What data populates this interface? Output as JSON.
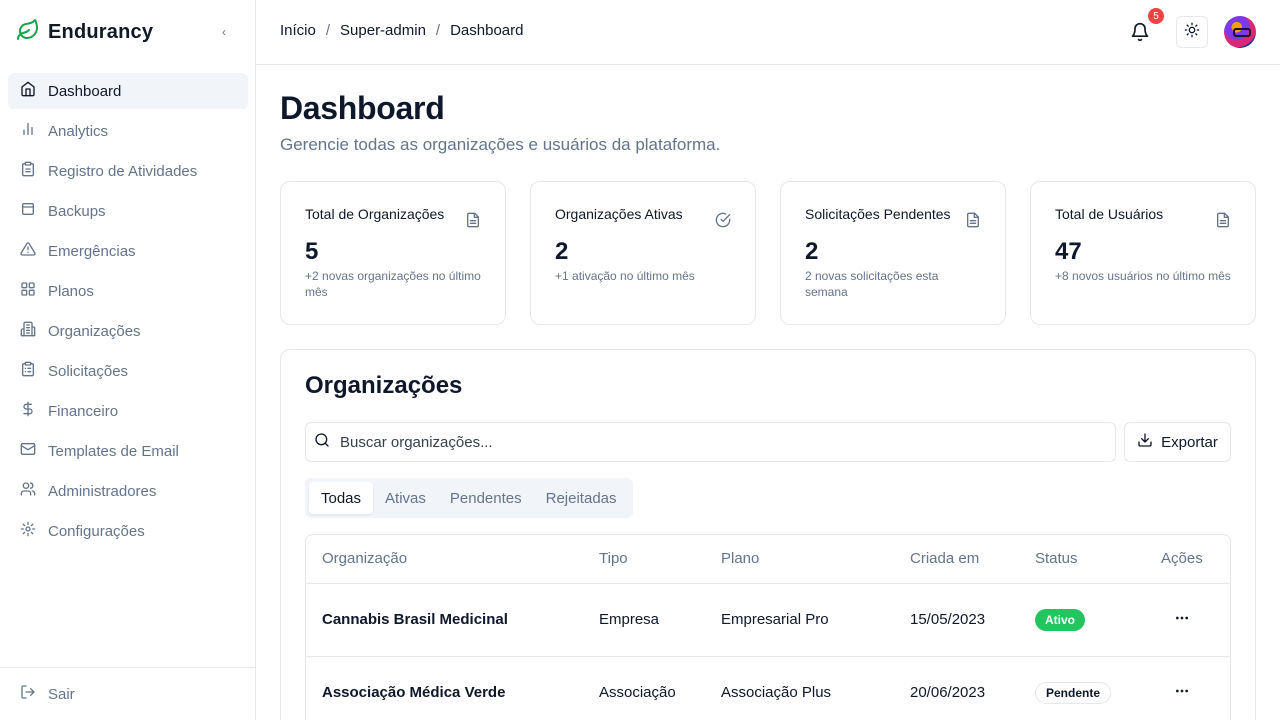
{
  "app": {
    "name": "Endurancy",
    "brand_color": "#16a34a"
  },
  "sidebar": {
    "collapse_icon": "chevron-left-icon",
    "items": [
      {
        "label": "Dashboard",
        "icon": "home-icon",
        "active": true
      },
      {
        "label": "Analytics",
        "icon": "bar-chart-icon"
      },
      {
        "label": "Registro de Atividades",
        "icon": "clipboard-icon"
      },
      {
        "label": "Backups",
        "icon": "database-icon"
      },
      {
        "label": "Emergências",
        "icon": "alert-triangle-icon"
      },
      {
        "label": "Planos",
        "icon": "grid-icon"
      },
      {
        "label": "Organizações",
        "icon": "building-icon"
      },
      {
        "label": "Solicitações",
        "icon": "clipboard-list-icon"
      },
      {
        "label": "Financeiro",
        "icon": "dollar-icon"
      },
      {
        "label": "Templates de Email",
        "icon": "mail-icon"
      },
      {
        "label": "Administradores",
        "icon": "users-icon"
      },
      {
        "label": "Configurações",
        "icon": "settings-icon"
      }
    ],
    "logout_label": "Sair"
  },
  "header": {
    "breadcrumb": [
      "Início",
      "Super-admin",
      "Dashboard"
    ],
    "separator": "/",
    "notification_count": "5",
    "notification_color": "#ef4444"
  },
  "page": {
    "title": "Dashboard",
    "subtitle": "Gerencie todas as organizações e usuários da plataforma."
  },
  "stats": [
    {
      "label": "Total de Organizações",
      "value": "5",
      "note": "+2 novas organizações no último mês",
      "icon": "file-icon"
    },
    {
      "label": "Organizações Ativas",
      "value": "2",
      "note": "+1 ativação no último mês",
      "icon": "check-circle-icon"
    },
    {
      "label": "Solicitações Pendentes",
      "value": "2",
      "note": "2 novas solicitações esta semana",
      "icon": "file-icon"
    },
    {
      "label": "Total de Usuários",
      "value": "47",
      "note": "+8 novos usuários no último mês",
      "icon": "file-icon"
    }
  ],
  "organizations": {
    "title": "Organizações",
    "search_placeholder": "Buscar organizações...",
    "export_label": "Exportar",
    "tabs": [
      {
        "label": "Todas",
        "active": true
      },
      {
        "label": "Ativas"
      },
      {
        "label": "Pendentes"
      },
      {
        "label": "Rejeitadas"
      }
    ],
    "columns": [
      "Organização",
      "Tipo",
      "Plano",
      "Criada em",
      "Status",
      "Ações"
    ],
    "rows": [
      {
        "name": "Cannabis Brasil Medicinal",
        "type": "Empresa",
        "plan": "Empresarial Pro",
        "created": "15/05/2023",
        "status": "Ativo",
        "status_kind": "ativo"
      },
      {
        "name": "Associação Médica Verde",
        "type": "Associação",
        "plan": "Associação Plus",
        "created": "20/06/2023",
        "status": "Pendente",
        "status_kind": "pendente"
      }
    ],
    "status_colors": {
      "ativo": "#22c55e"
    }
  }
}
